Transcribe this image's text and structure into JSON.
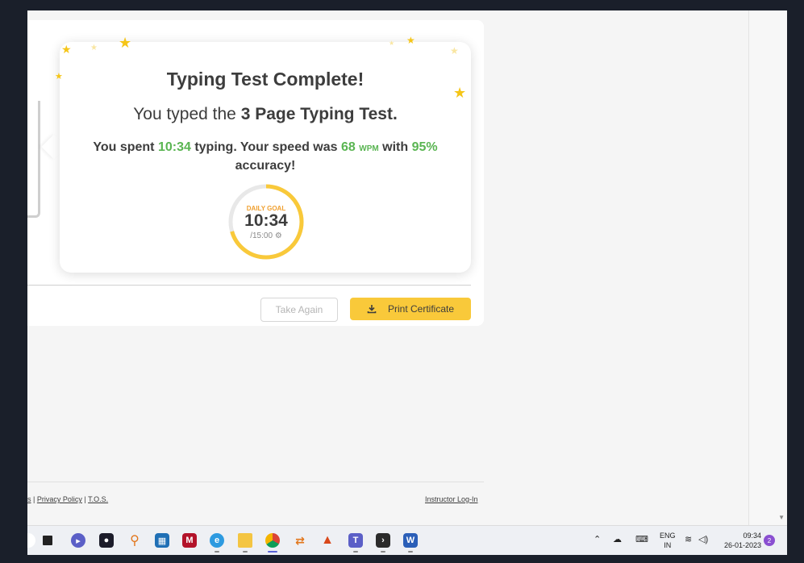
{
  "popup": {
    "title": "Typing Test Complete!",
    "subtitle_prefix": "You typed the ",
    "subtitle_bold": "3 Page Typing Test.",
    "stats": {
      "t1": "You spent ",
      "time": "10:34",
      "t2": " typing. Your speed was ",
      "wpm": "68",
      "wpm_unit": "WPM",
      "t3": " with ",
      "accuracy": "95%",
      "t4": " accuracy!"
    },
    "goal": {
      "label": "DAILY GOAL",
      "time": "10:34",
      "target": "/15:00",
      "progress": 0.705,
      "settings_icon": "gear-icon"
    }
  },
  "actions": {
    "take_again": "Take Again",
    "print_certificate": "Print Certificate",
    "print_icon": "download-icon"
  },
  "footer": {
    "partial_link": "s",
    "separator": "|",
    "privacy": "Privacy Policy",
    "tos": "T.O.S.",
    "instructor": "Instructor Log-In"
  },
  "taskbar": {
    "lang_top": "ENG",
    "lang_bottom": "IN",
    "time": "09:34",
    "date": "26-01-2023",
    "notifications": "2",
    "apps": [
      "file-explorer-icon",
      "teams-chat-icon",
      "davinci-icon",
      "search-tool-icon",
      "store-icon",
      "mendeley-icon",
      "edge-icon",
      "folder-icon",
      "chrome-icon",
      "sync-icon",
      "matlab-icon",
      "teams-icon",
      "terminal-icon",
      "word-icon"
    ]
  },
  "colors": {
    "accent_green": "#5ab552",
    "goal_yellow": "#f9c93a",
    "goal_label": "#f0a030"
  }
}
